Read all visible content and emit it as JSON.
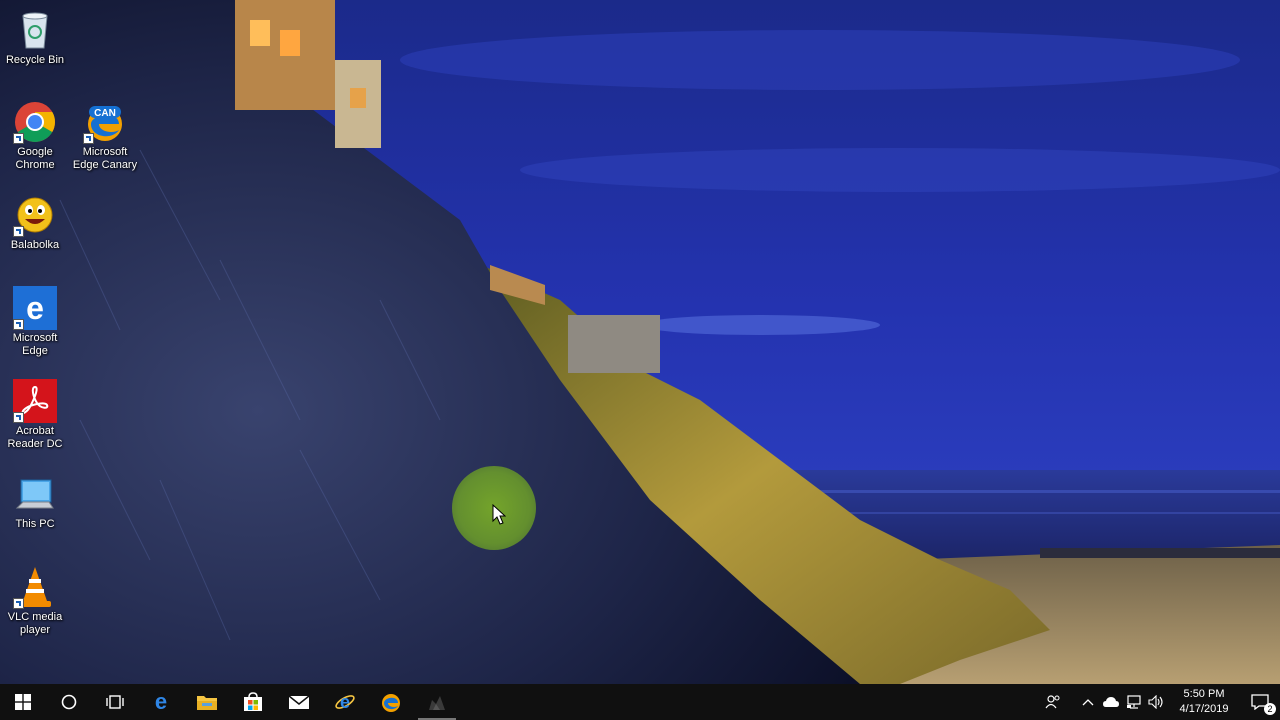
{
  "desktop": {
    "icons": [
      {
        "label": "Recycle Bin",
        "icon": "recycle-bin-icon"
      },
      {
        "label": "Google Chrome",
        "icon": "chrome-icon"
      },
      {
        "label": "Microsoft Edge Canary",
        "icon": "edge-canary-icon",
        "badge": "CAN"
      },
      {
        "label": "Balabolka",
        "icon": "balabolka-icon"
      },
      {
        "label": "Microsoft Edge",
        "icon": "edge-icon"
      },
      {
        "label": "Acrobat Reader DC",
        "icon": "acrobat-icon"
      },
      {
        "label": "This PC",
        "icon": "this-pc-icon"
      },
      {
        "label": "VLC media player",
        "icon": "vlc-icon"
      }
    ]
  },
  "taskbar": {
    "buttons": [
      {
        "name": "start",
        "icon": "windows-start-icon"
      },
      {
        "name": "search",
        "icon": "cortana-search-icon"
      },
      {
        "name": "task-view",
        "icon": "task-view-icon"
      },
      {
        "name": "edge",
        "icon": "edge-icon"
      },
      {
        "name": "file-explorer",
        "icon": "folder-icon"
      },
      {
        "name": "store",
        "icon": "store-icon"
      },
      {
        "name": "mail",
        "icon": "mail-icon"
      },
      {
        "name": "edge-legacy",
        "icon": "ie-edge-icon"
      },
      {
        "name": "edge-canary",
        "icon": "edge-canary-icon"
      },
      {
        "name": "balabolka",
        "icon": "balabolka-icon"
      }
    ],
    "tray": {
      "time": "5:50 PM",
      "date": "4/17/2019",
      "notification_count": "2"
    }
  },
  "colors": {
    "accent": "#0078d7",
    "taskbar": "#101010",
    "cursor_highlight": "#7aa62a"
  }
}
